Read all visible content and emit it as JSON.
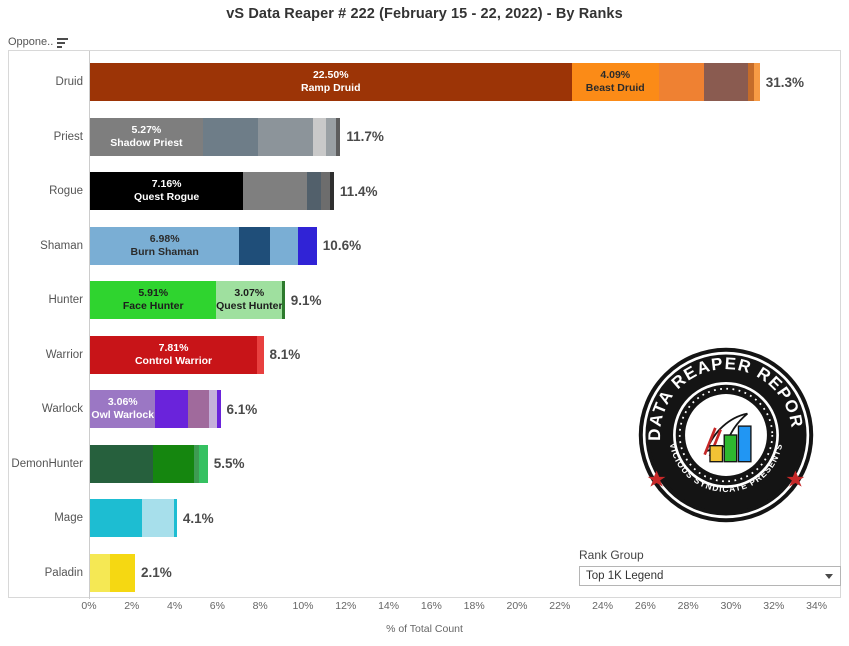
{
  "header": {
    "title": "vS Data Reaper #  222 (February 15 - 22, 2022) - By Ranks",
    "field_caption": "Oppone..",
    "sort_icon": "sort-icon"
  },
  "controls": {
    "rank_group_label": "Rank Group",
    "rank_group_value": "Top 1K Legend",
    "caret_icon": "chevron-down-icon"
  },
  "logo": {
    "top_text": "DATA REAPER REPORT",
    "bottom_text": "VICIOUS SYNDICATE PRESENTS"
  },
  "chart_data": {
    "type": "bar",
    "orientation": "horizontal",
    "stacked": true,
    "title": "vS Data Reaper #  222 (February 15 - 22, 2022) - By Ranks",
    "xlabel": "% of Total Count",
    "ylabel": "Oppone..",
    "xlim": [
      0,
      34
    ],
    "xticks": [
      "0%",
      "2%",
      "4%",
      "6%",
      "8%",
      "10%",
      "12%",
      "14%",
      "16%",
      "18%",
      "20%",
      "22%",
      "24%",
      "26%",
      "28%",
      "30%",
      "32%",
      "34%"
    ],
    "xtick_values": [
      0,
      2,
      4,
      6,
      8,
      10,
      12,
      14,
      16,
      18,
      20,
      22,
      24,
      26,
      28,
      30,
      32,
      34
    ],
    "grid": false,
    "categories": [
      "Druid",
      "Priest",
      "Rogue",
      "Shaman",
      "Hunter",
      "Warrior",
      "Warlock",
      "DemonHunter",
      "Mage",
      "Paladin"
    ],
    "values": [
      31.3,
      11.7,
      11.4,
      10.6,
      9.1,
      8.1,
      6.1,
      5.5,
      4.1,
      2.1
    ],
    "rows": [
      {
        "category": "Druid",
        "total_label": "31.3%",
        "total": 31.3,
        "segments": [
          {
            "value": 22.5,
            "pct_label": "22.50%",
            "name": "Ramp Druid",
            "color": "#9c3406",
            "text_color": "#ffffff"
          },
          {
            "value": 4.09,
            "pct_label": "4.09%",
            "name": "Beast Druid",
            "color": "#fb8b17",
            "text_color": "#2b2b2b"
          },
          {
            "value": 2.1,
            "pct_label": "",
            "name": "",
            "color": "#ef8132",
            "text_color": "#ffffff"
          },
          {
            "value": 2.05,
            "pct_label": "",
            "name": "",
            "color": "#8a5b50",
            "text_color": "#ffffff"
          },
          {
            "value": 0.3,
            "pct_label": "",
            "name": "",
            "color": "#c56c2a",
            "text_color": "#ffffff"
          },
          {
            "value": 0.26,
            "pct_label": "",
            "name": "",
            "color": "#f79b45",
            "text_color": "#ffffff"
          }
        ]
      },
      {
        "category": "Priest",
        "total_label": "11.7%",
        "total": 11.7,
        "segments": [
          {
            "value": 5.27,
            "pct_label": "5.27%",
            "name": "Shadow Priest",
            "color": "#7e7e7e",
            "text_color": "#ffffff"
          },
          {
            "value": 2.6,
            "pct_label": "",
            "name": "",
            "color": "#6e7d88",
            "text_color": "#ffffff"
          },
          {
            "value": 2.55,
            "pct_label": "",
            "name": "",
            "color": "#8c949a",
            "text_color": "#ffffff"
          },
          {
            "value": 0.6,
            "pct_label": "",
            "name": "",
            "color": "#c9c9c9",
            "text_color": "#333333"
          },
          {
            "value": 0.5,
            "pct_label": "",
            "name": "",
            "color": "#9aa0a4",
            "text_color": "#ffffff"
          },
          {
            "value": 0.18,
            "pct_label": "",
            "name": "",
            "color": "#5d5d5d",
            "text_color": "#ffffff"
          }
        ]
      },
      {
        "category": "Rogue",
        "total_label": "11.4%",
        "total": 11.4,
        "segments": [
          {
            "value": 7.16,
            "pct_label": "7.16%",
            "name": "Quest Rogue",
            "color": "#000000",
            "text_color": "#ffffff"
          },
          {
            "value": 3.0,
            "pct_label": "",
            "name": "",
            "color": "#7f7f7f",
            "text_color": "#ffffff"
          },
          {
            "value": 0.62,
            "pct_label": "",
            "name": "",
            "color": "#52606b",
            "text_color": "#ffffff"
          },
          {
            "value": 0.45,
            "pct_label": "",
            "name": "",
            "color": "#6d6d6d",
            "text_color": "#ffffff"
          },
          {
            "value": 0.17,
            "pct_label": "",
            "name": "",
            "color": "#2f2f2f",
            "text_color": "#ffffff"
          }
        ]
      },
      {
        "category": "Shaman",
        "total_label": "10.6%",
        "total": 10.6,
        "segments": [
          {
            "value": 6.98,
            "pct_label": "6.98%",
            "name": "Burn Shaman",
            "color": "#7aaed4",
            "text_color": "#2b2b2b"
          },
          {
            "value": 1.45,
            "pct_label": "",
            "name": "",
            "color": "#1f4e79",
            "text_color": "#ffffff"
          },
          {
            "value": 1.3,
            "pct_label": "",
            "name": "",
            "color": "#7aaed4",
            "text_color": "#ffffff"
          },
          {
            "value": 0.87,
            "pct_label": "",
            "name": "",
            "color": "#3023d6",
            "text_color": "#ffffff"
          }
        ]
      },
      {
        "category": "Hunter",
        "total_label": "9.1%",
        "total": 9.1,
        "segments": [
          {
            "value": 5.91,
            "pct_label": "5.91%",
            "name": "Face Hunter",
            "color": "#2fd42f",
            "text_color": "#1d1d1d"
          },
          {
            "value": 3.07,
            "pct_label": "3.07%",
            "name": "Quest Hunter",
            "color": "#9fe09f",
            "text_color": "#1d1d1d"
          },
          {
            "value": 0.12,
            "pct_label": "",
            "name": "",
            "color": "#2d7a2d",
            "text_color": "#ffffff"
          }
        ]
      },
      {
        "category": "Warrior",
        "total_label": "8.1%",
        "total": 8.1,
        "segments": [
          {
            "value": 7.81,
            "pct_label": "7.81%",
            "name": "Control Warrior",
            "color": "#c81418",
            "text_color": "#ffffff"
          },
          {
            "value": 0.3,
            "pct_label": "",
            "name": "",
            "color": "#e8403f",
            "text_color": "#ffffff"
          }
        ]
      },
      {
        "category": "Warlock",
        "total_label": "6.1%",
        "total": 6.1,
        "segments": [
          {
            "value": 3.06,
            "pct_label": "3.06%",
            "name": "Owl Warlock",
            "color": "#9b77c4",
            "text_color": "#ffffff"
          },
          {
            "value": 1.5,
            "pct_label": "",
            "name": "",
            "color": "#6a23db",
            "text_color": "#ffffff"
          },
          {
            "value": 1.0,
            "pct_label": "",
            "name": "",
            "color": "#a06a9c",
            "text_color": "#ffffff"
          },
          {
            "value": 0.38,
            "pct_label": "",
            "name": "",
            "color": "#c5b0da",
            "text_color": "#ffffff"
          },
          {
            "value": 0.16,
            "pct_label": "",
            "name": "",
            "color": "#6a23db",
            "text_color": "#ffffff"
          }
        ]
      },
      {
        "category": "DemonHunter",
        "total_label": "5.5%",
        "total": 5.5,
        "segments": [
          {
            "value": 2.95,
            "pct_label": "",
            "name": "",
            "color": "#26603d",
            "text_color": "#ffffff"
          },
          {
            "value": 1.9,
            "pct_label": "",
            "name": "",
            "color": "#15860f",
            "text_color": "#ffffff"
          },
          {
            "value": 0.26,
            "pct_label": "",
            "name": "",
            "color": "#3e9b52",
            "text_color": "#ffffff"
          },
          {
            "value": 0.39,
            "pct_label": "",
            "name": "",
            "color": "#35c161",
            "text_color": "#ffffff"
          }
        ]
      },
      {
        "category": "Mage",
        "total_label": "4.1%",
        "total": 4.1,
        "segments": [
          {
            "value": 2.42,
            "pct_label": "",
            "name": "",
            "color": "#1dbdd2",
            "text_color": "#ffffff"
          },
          {
            "value": 1.5,
            "pct_label": "",
            "name": "",
            "color": "#a7dfeb",
            "text_color": "#333333"
          },
          {
            "value": 0.14,
            "pct_label": "",
            "name": "",
            "color": "#1dbdd2",
            "text_color": "#ffffff"
          }
        ]
      },
      {
        "category": "Paladin",
        "total_label": "2.1%",
        "total": 2.1,
        "segments": [
          {
            "value": 0.95,
            "pct_label": "",
            "name": "",
            "color": "#f5e854",
            "text_color": "#333333"
          },
          {
            "value": 1.15,
            "pct_label": "",
            "name": "",
            "color": "#f5d812",
            "text_color": "#333333"
          }
        ]
      }
    ]
  }
}
